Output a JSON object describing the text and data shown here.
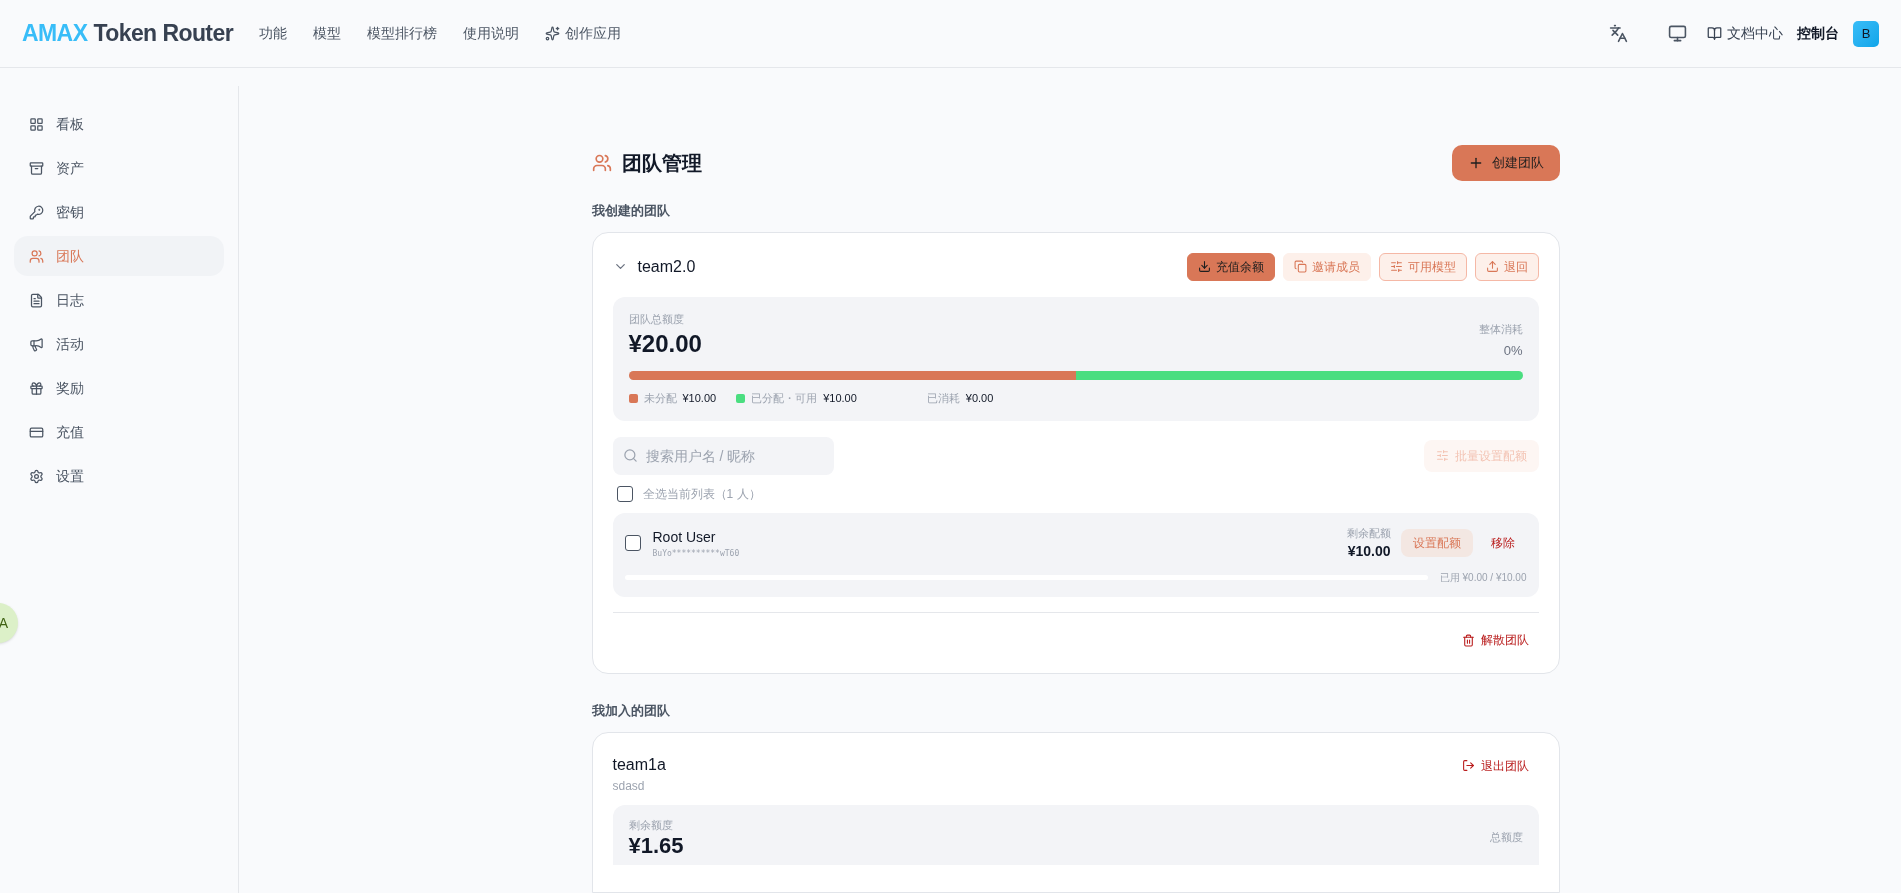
{
  "header": {
    "logo_accent": "AMAX",
    "logo_rest": "Token Router",
    "nav": [
      {
        "label": "功能"
      },
      {
        "label": "模型"
      },
      {
        "label": "模型排行榜"
      },
      {
        "label": "使用说明"
      },
      {
        "label": "创作应用"
      }
    ],
    "docs": "文档中心",
    "console": "控制台",
    "avatar": "B"
  },
  "sidebar": {
    "items": [
      {
        "label": "看板",
        "selected": false
      },
      {
        "label": "资产",
        "selected": false
      },
      {
        "label": "密钥",
        "selected": false
      },
      {
        "label": "团队",
        "selected": true
      },
      {
        "label": "日志",
        "selected": false
      },
      {
        "label": "活动",
        "selected": false
      },
      {
        "label": "奖励",
        "selected": false
      },
      {
        "label": "充值",
        "selected": false
      },
      {
        "label": "设置",
        "selected": false
      }
    ]
  },
  "floating_badge": "A",
  "page": {
    "title": "团队管理",
    "create_button": "创建团队",
    "created_heading": "我创建的团队",
    "joined_heading": "我加入的团队"
  },
  "created_team": {
    "name": "team2.0",
    "expanded": true,
    "actions": [
      {
        "label": "充值余额",
        "kind": "primary"
      },
      {
        "label": "邀请成员",
        "kind": "soft"
      },
      {
        "label": "可用模型",
        "kind": "outline"
      },
      {
        "label": "退回",
        "kind": "outline"
      }
    ],
    "total_label": "团队总额度",
    "total": "¥20.00",
    "usage_label": "整体消耗",
    "usage": "0%",
    "segments": [
      {
        "label": "未分配",
        "amount": "¥10.00",
        "color": "#d97757",
        "level": 0.5
      },
      {
        "label": "已分配・可用",
        "amount": "¥10.00",
        "color": "#4ade80",
        "level": 0.5
      }
    ],
    "consumed_label": "已消耗",
    "consumed": "¥0.00",
    "search_placeholder": "搜索用户名 / 昵称",
    "batch_button": "批量设置配额",
    "batch_disabled": true,
    "select_all": {
      "label": "全选当前列表（1 人）",
      "checked": false
    },
    "members": [
      {
        "name": "Root User",
        "key": "BuYo**********wT60",
        "checked": false,
        "remaining_label": "剩余配额",
        "remaining": "¥10.00",
        "set_button": "设置配额",
        "remove_button": "移除",
        "used": "已用 ¥0.00 / ¥10.00"
      }
    ],
    "disband": "解散团队"
  },
  "joined_team": {
    "name": "team1a",
    "description": "sdasd",
    "leave": "退出团队",
    "remaining_label": "剩余额度",
    "remaining": "¥1.65",
    "total_label": "总额度"
  }
}
